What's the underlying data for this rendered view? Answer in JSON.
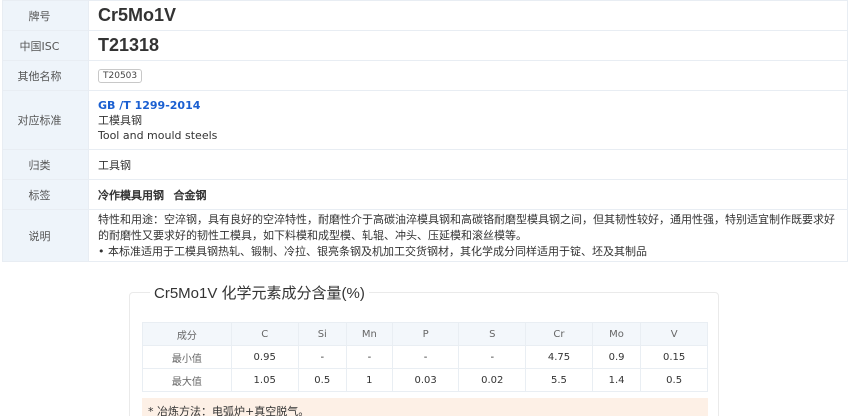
{
  "grade": {
    "label": "牌号",
    "value": "Cr5Mo1V"
  },
  "isc": {
    "label": "中国ISC",
    "value": "T21318"
  },
  "other_names": {
    "label": "其他名称",
    "tags": [
      "T20503"
    ]
  },
  "standard": {
    "label": "对应标准",
    "link": "GB /T 1299-2014",
    "name_cn": "工模具钢",
    "name_en": "Tool and mould steels"
  },
  "category": {
    "label": "归类",
    "value": "工具钢"
  },
  "labels": {
    "label": "标签",
    "tags": [
      "冷作模具用钢",
      "合金钢"
    ]
  },
  "description": {
    "label": "说明",
    "line1": "特性和用途：空淬钢，具有良好的空淬特性，耐磨性介于高碳油淬模具钢和高碳铬耐磨型模具钢之间，但其韧性较好，通用性强，特别适宜制作既要求好的耐磨性又要求好的韧性工模具，如下料模和成型模、轧辊、冲头、压延模和滚丝模等。",
    "line2": "• 本标准适用于工模具钢热轧、锻制、冷拉、银亮条钢及机加工交货钢材，其化学成分同样适用于锭、坯及其制品"
  },
  "chem": {
    "title": "Cr5Mo1V 化学元素成分含量(%)",
    "header": [
      "成分",
      "C",
      "Si",
      "Mn",
      "P",
      "S",
      "Cr",
      "Mo",
      "V"
    ],
    "rows": [
      [
        "最小值",
        "0.95",
        "-",
        "-",
        "-",
        "-",
        "4.75",
        "0.9",
        "0.15"
      ],
      [
        "最大值",
        "1.05",
        "0.5",
        "1",
        "0.03",
        "0.02",
        "5.5",
        "1.4",
        "0.5"
      ]
    ],
    "note": "* 冶炼方法：电弧炉+真空脱气。"
  }
}
